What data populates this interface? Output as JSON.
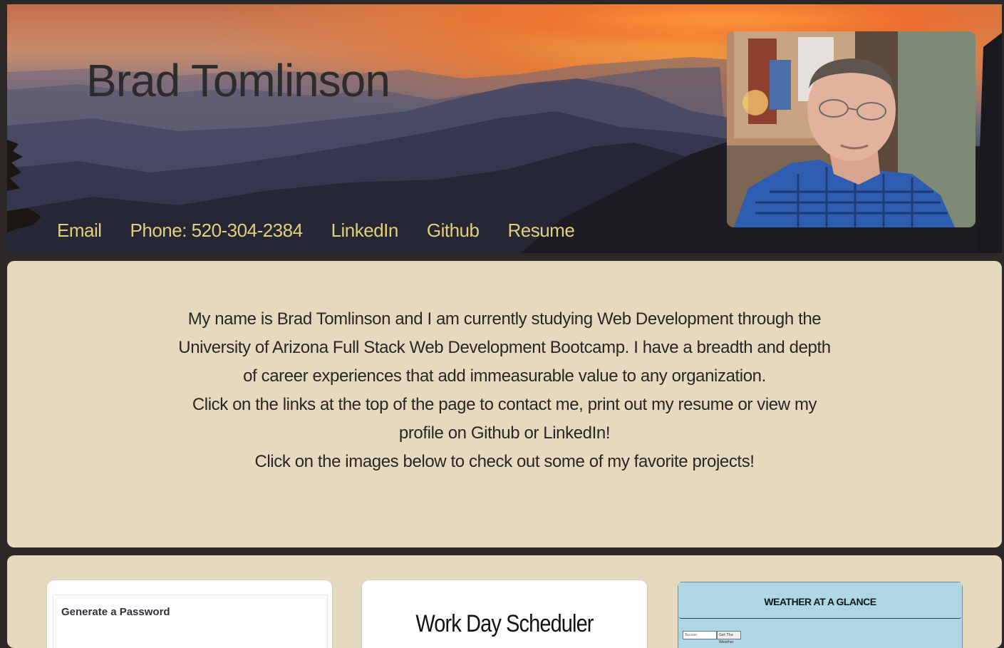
{
  "header": {
    "title": "Brad Tomlinson",
    "nav": [
      "Email",
      "Phone: 520-304-2384",
      "LinkedIn",
      "Github",
      "Resume"
    ]
  },
  "about": {
    "paragraphs": [
      "My name is Brad Tomlinson and I am currently studying Web Development through the University of Arizona Full Stack Web Development Bootcamp. I have a breadth and depth of career experiences that add immeasurable value to any organization.",
      "Click on the links at the top of the page to contact me, print out my resume or view my profile on Github or LinkedIn!",
      "Click on the images below to check out some of my favorite projects!"
    ]
  },
  "projects": [
    {
      "caption": "Generate a Password"
    },
    {
      "caption": "Work Day Scheduler"
    },
    {
      "caption": "WEATHER AT A GLANCE",
      "input_placeholder": "Tucson",
      "button_label": "Get The Weather"
    }
  ],
  "colors": {
    "page_bg": "#2b2827",
    "panel_bg": "#e5d9c0",
    "nav_link": "#e2cf7b",
    "title_text": "#2d2b2c"
  }
}
